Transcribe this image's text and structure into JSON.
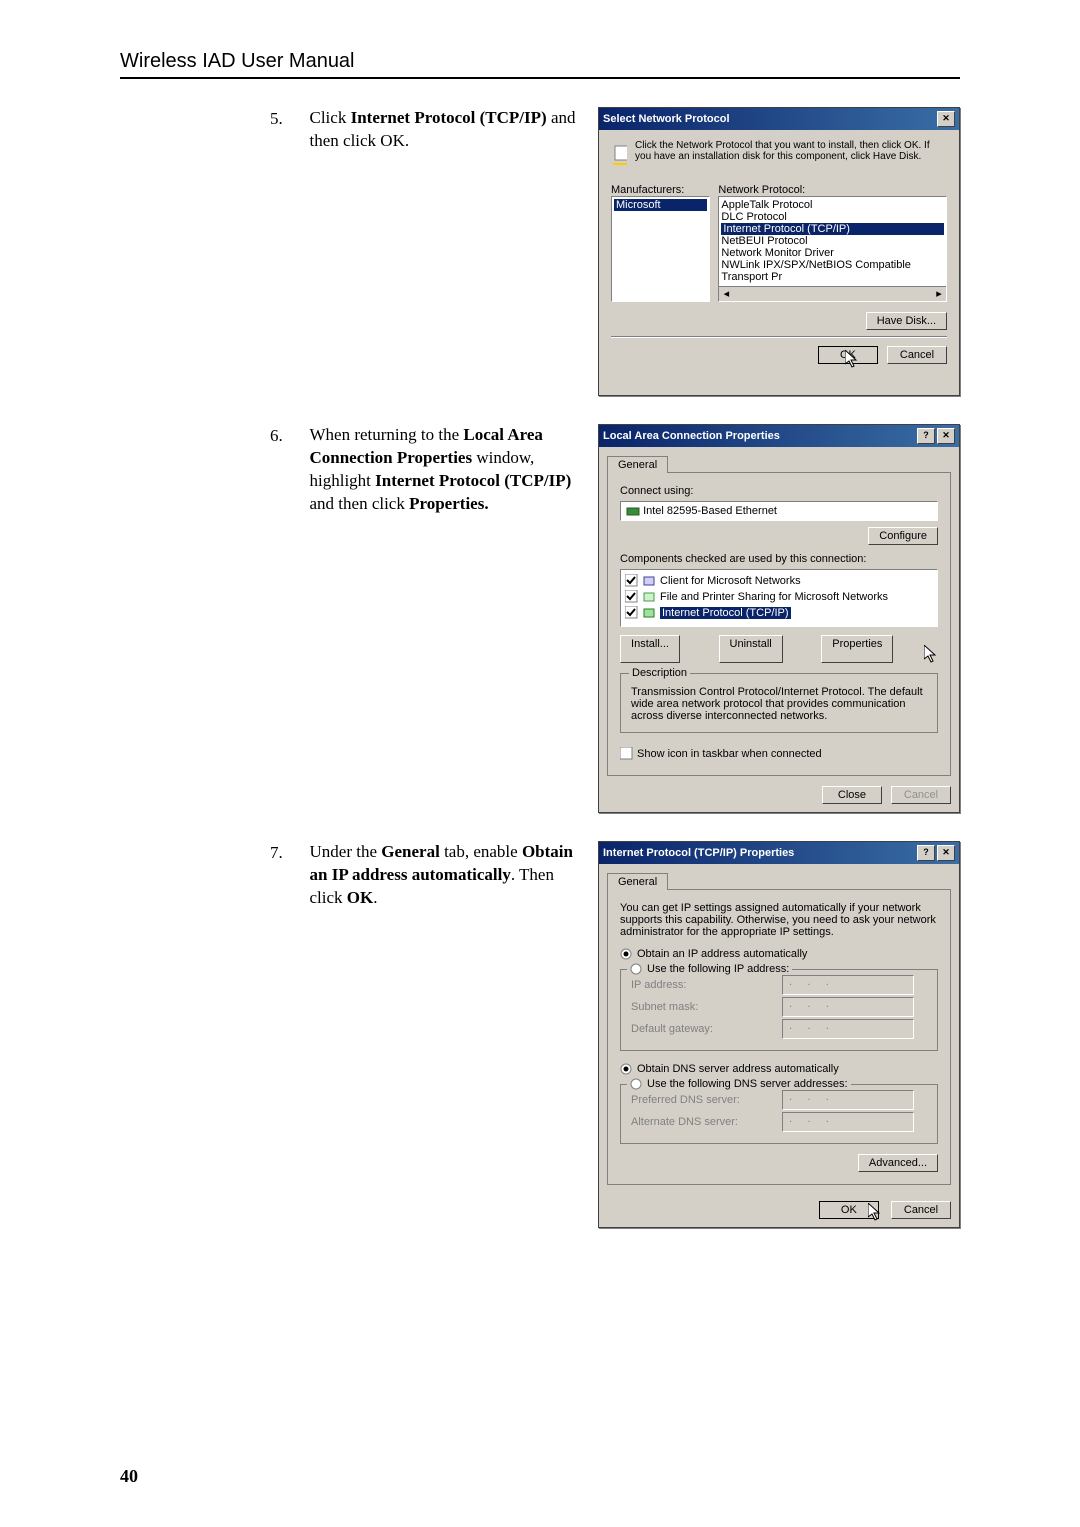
{
  "header": {
    "title": "Wireless IAD User Manual"
  },
  "page_number": "40",
  "steps": {
    "s5": {
      "num": "5.",
      "pre": "Click ",
      "bold": "Internet Protocol (TCP/IP)",
      "post": " and then click OK."
    },
    "s6": {
      "num": "6.",
      "t1": "When returning to the ",
      "b1": "Local Area Connection Properties",
      "t2": " window, highlight ",
      "b2": "Internet Protocol (TCP/IP)",
      "t3": " and then click ",
      "b3": "Properties."
    },
    "s7": {
      "num": "7.",
      "t1": "Under the ",
      "b1": "General",
      "t2": " tab, enable ",
      "b2": "Obtain an IP address automatically",
      "t3": ". Then click ",
      "b3": "OK",
      "t4": "."
    }
  },
  "dlg1": {
    "title": "Select Network Protocol",
    "close": "✕",
    "desc": "Click the Network Protocol that you want to install, then click OK. If you have an installation disk for this component, click Have Disk.",
    "mfr_label": "Manufacturers:",
    "proto_label": "Network Protocol:",
    "mfr_list": [
      "Microsoft"
    ],
    "proto_list": {
      "a": "AppleTalk Protocol",
      "b": "DLC Protocol",
      "sel": "Internet Protocol (TCP/IP)",
      "c": "NetBEUI Protocol",
      "d": "Network Monitor Driver",
      "e": "NWLink IPX/SPX/NetBIOS Compatible Transport Pr"
    },
    "havedisk": "Have Disk...",
    "ok": "OK",
    "cancel": "Cancel"
  },
  "dlg2": {
    "title": "Local Area Connection Properties",
    "help": "?",
    "close": "✕",
    "tab": "General",
    "connect_using": "Connect using:",
    "adapter": "Intel 82595-Based Ethernet",
    "configure": "Configure",
    "components_label": "Components checked are used by this connection:",
    "components": {
      "a": "Client for Microsoft Networks",
      "b": "File and Printer Sharing for Microsoft Networks",
      "sel": "Internet Protocol (TCP/IP)"
    },
    "install": "Install...",
    "uninstall": "Uninstall",
    "properties": "Properties",
    "desc_label": "Description",
    "desc": "Transmission Control Protocol/Internet Protocol. The default wide area network protocol that provides communication across diverse interconnected networks.",
    "show_icon": "Show icon in taskbar when connected",
    "close_btn": "Close",
    "cancel": "Cancel"
  },
  "dlg3": {
    "title": "Internet Protocol (TCP/IP) Properties",
    "help": "?",
    "close": "✕",
    "tab": "General",
    "intro": "You can get IP settings assigned automatically if your network supports this capability. Otherwise, you need to ask your network administrator for the appropriate IP settings.",
    "r_auto_ip": "Obtain an IP address automatically",
    "r_use_ip": "Use the following IP address:",
    "ip_addr": "IP address:",
    "subnet": "Subnet mask:",
    "gateway": "Default gateway:",
    "r_auto_dns": "Obtain DNS server address automatically",
    "r_use_dns": "Use the following DNS server addresses:",
    "pref_dns": "Preferred DNS server:",
    "alt_dns": "Alternate DNS server:",
    "advanced": "Advanced...",
    "ok": "OK",
    "cancel": "Cancel"
  }
}
